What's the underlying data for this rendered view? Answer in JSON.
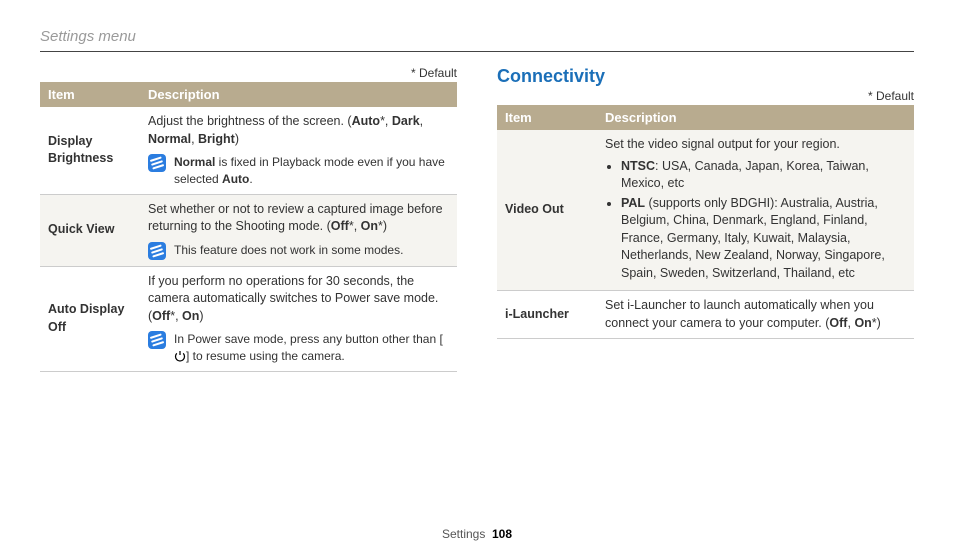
{
  "header": {
    "title": "Settings menu"
  },
  "defaultNote": "* Default",
  "col_left": {
    "table": {
      "headers": {
        "item": "Item",
        "desc": "Description"
      },
      "rows": [
        {
          "item": "Display Brightness",
          "desc_pre": "Adjust the brightness of the screen. (",
          "opt_auto": "Auto",
          "star1": "*, ",
          "opt_dark": "Dark",
          "c1": ", ",
          "opt_normal": "Normal",
          "c2": ", ",
          "opt_bright": "Bright",
          "close": ")",
          "note_b1": "Normal",
          "note_rest": " is fixed in Playback mode even if you have selected ",
          "note_b2": "Auto",
          "note_end": "."
        },
        {
          "item": "Quick View",
          "desc": "Set whether or not to review a captured image before returning to the Shooting mode. (",
          "opt_off": "Off",
          "star": "*, ",
          "opt_on": "On",
          "star2": "*)",
          "note": "This feature does not work in some modes."
        },
        {
          "item": "Auto Display Off",
          "desc": "If you perform no operations for 30 seconds, the camera automatically switches to Power save mode. (",
          "opt_off": "Off",
          "star": "*, ",
          "opt_on": "On",
          "close": ")",
          "note_pre": "In Power save mode, press any button other than [",
          "note_post": "] to resume using the camera."
        }
      ]
    }
  },
  "col_right": {
    "section_title": "Connectivity",
    "table": {
      "headers": {
        "item": "Item",
        "desc": "Description"
      },
      "rows": [
        {
          "item": "Video Out",
          "desc": "Set the video signal output for your region.",
          "b1": {
            "label": "NTSC",
            "text": ": USA, Canada, Japan, Korea, Taiwan, Mexico, etc"
          },
          "b2": {
            "label": "PAL",
            "paren": " (supports only BDGHI)",
            "text": ": Australia, Austria, Belgium, China, Denmark, England, Finland, France, Germany, Italy, Kuwait, Malaysia, Netherlands, New Zealand, Norway, Singapore, Spain, Sweden, Switzerland, Thailand, etc"
          }
        },
        {
          "item": "i-Launcher",
          "desc": "Set i-Launcher to launch automatically when you connect your camera to your computer. (",
          "opt_off": "Off",
          "c": ", ",
          "opt_on": "On",
          "star": "*)"
        }
      ]
    }
  },
  "footer": {
    "label": "Settings",
    "page": "108"
  }
}
